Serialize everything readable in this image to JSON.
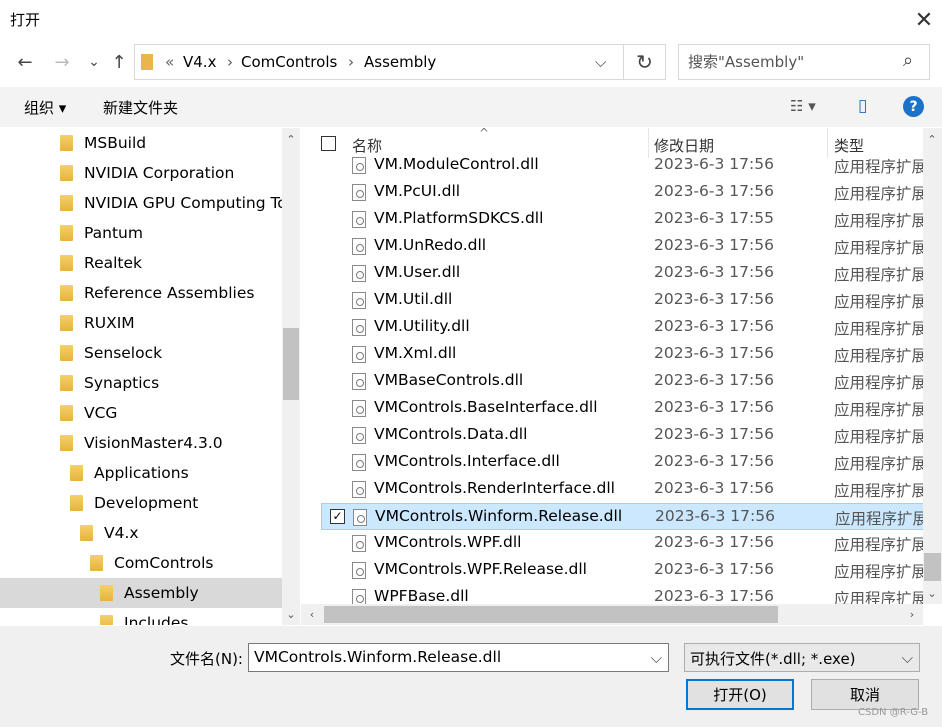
{
  "window": {
    "title": "打开",
    "close": "✕"
  },
  "address": {
    "prefix": "«",
    "breadcrumbs": [
      "V4.x",
      "ComControls",
      "Assembly"
    ],
    "separator": "›",
    "dropdown": "⌵",
    "refresh": "↻",
    "search_placeholder": "搜索\"Assembly\"",
    "search_icon": "⌕"
  },
  "nav_buttons": {
    "back": "←",
    "forward": "→",
    "recent": "⌄",
    "up": "↑"
  },
  "toolbar": {
    "organize": "组织 ▾",
    "new_folder": "新建文件夹",
    "view": "☷ ▾",
    "preview": "▯",
    "help": "?"
  },
  "tree": [
    {
      "label": "MSBuild"
    },
    {
      "label": "NVIDIA Corporation"
    },
    {
      "label": "NVIDIA GPU Computing To"
    },
    {
      "label": "Pantum"
    },
    {
      "label": "Realtek"
    },
    {
      "label": "Reference Assemblies"
    },
    {
      "label": "RUXIM"
    },
    {
      "label": "Senselock"
    },
    {
      "label": "Synaptics"
    },
    {
      "label": "VCG"
    },
    {
      "label": "VisionMaster4.3.0"
    },
    {
      "label": "Applications"
    },
    {
      "label": "Development"
    },
    {
      "label": "V4.x"
    },
    {
      "label": "ComControls"
    },
    {
      "label": "Assembly",
      "selected": true
    },
    {
      "label": "Includes"
    }
  ],
  "columns": {
    "name": "名称",
    "date": "修改日期",
    "type": "类型",
    "sort_arrow": "^"
  },
  "files": [
    {
      "name": "VM.ModuleControl.dll",
      "date": "2023-6-3 17:56",
      "type": "应用程序扩展"
    },
    {
      "name": "VM.PcUI.dll",
      "date": "2023-6-3 17:56",
      "type": "应用程序扩展"
    },
    {
      "name": "VM.PlatformSDKCS.dll",
      "date": "2023-6-3 17:55",
      "type": "应用程序扩展"
    },
    {
      "name": "VM.UnRedo.dll",
      "date": "2023-6-3 17:56",
      "type": "应用程序扩展"
    },
    {
      "name": "VM.User.dll",
      "date": "2023-6-3 17:56",
      "type": "应用程序扩展"
    },
    {
      "name": "VM.Util.dll",
      "date": "2023-6-3 17:56",
      "type": "应用程序扩展"
    },
    {
      "name": "VM.Utility.dll",
      "date": "2023-6-3 17:56",
      "type": "应用程序扩展"
    },
    {
      "name": "VM.Xml.dll",
      "date": "2023-6-3 17:56",
      "type": "应用程序扩展"
    },
    {
      "name": "VMBaseControls.dll",
      "date": "2023-6-3 17:56",
      "type": "应用程序扩展"
    },
    {
      "name": "VMControls.BaseInterface.dll",
      "date": "2023-6-3 17:56",
      "type": "应用程序扩展"
    },
    {
      "name": "VMControls.Data.dll",
      "date": "2023-6-3 17:56",
      "type": "应用程序扩展"
    },
    {
      "name": "VMControls.Interface.dll",
      "date": "2023-6-3 17:56",
      "type": "应用程序扩展"
    },
    {
      "name": "VMControls.RenderInterface.dll",
      "date": "2023-6-3 17:56",
      "type": "应用程序扩展"
    },
    {
      "name": "VMControls.Winform.Release.dll",
      "date": "2023-6-3 17:56",
      "type": "应用程序扩展",
      "selected": true,
      "check": "✓"
    },
    {
      "name": "VMControls.WPF.dll",
      "date": "2023-6-3 17:56",
      "type": "应用程序扩展"
    },
    {
      "name": "VMControls.WPF.Release.dll",
      "date": "2023-6-3 17:56",
      "type": "应用程序扩展"
    },
    {
      "name": "WPFBase.dll",
      "date": "2023-6-3 17:56",
      "type": "应用程序扩展"
    }
  ],
  "scroll_arrows": {
    "up": "⌃",
    "down": "⌄",
    "left": "‹",
    "right": "›"
  },
  "bottom": {
    "filename_label": "文件名(N):",
    "filename_value": "VMControls.Winform.Release.dll",
    "filename_dropdown": "⌵",
    "filetype": "可执行文件(*.dll; *.exe)",
    "filetype_dropdown": "⌵",
    "open": "打开(O)",
    "cancel": "取消",
    "watermark": "CSDN @R-G-B"
  },
  "colors": {
    "selection": "#cce8ff",
    "selection_border": "#99d1ff",
    "accent": "#0078d7",
    "help": "#1a73c8"
  }
}
